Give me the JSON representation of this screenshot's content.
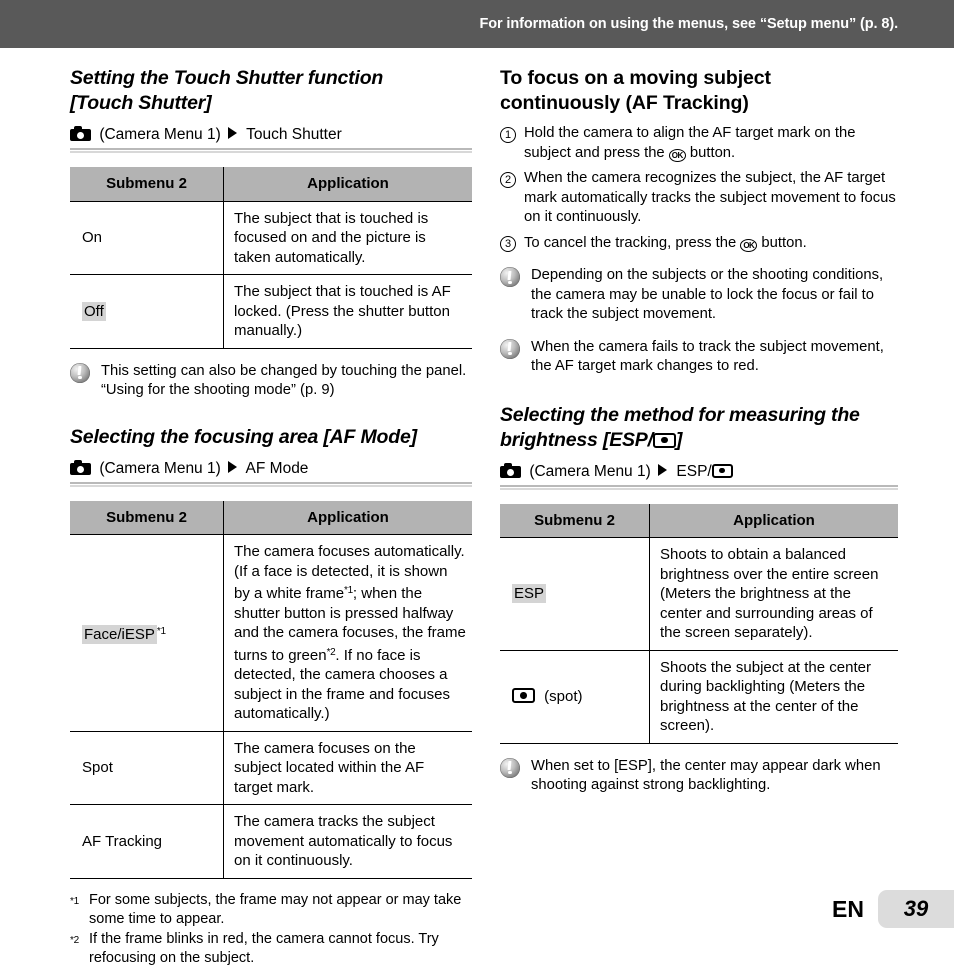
{
  "header": {
    "notice": "For information on using the menus, see “Setup menu” (p. 8)."
  },
  "left_column": {
    "touch_shutter": {
      "heading_line1": "Setting the Touch Shutter function",
      "heading_line2": "[Touch Shutter]",
      "menu_path_prefix": "(Camera Menu 1)",
      "menu_path_target": "Touch Shutter",
      "table": {
        "headers": [
          "Submenu 2",
          "Application"
        ],
        "rows": [
          {
            "submenu": "On",
            "submenu_highlighted": false,
            "application": "The subject that is touched is focused on and the picture is taken automatically."
          },
          {
            "submenu": "Off",
            "submenu_highlighted": true,
            "application": "The subject that is touched is AF locked. (Press the shutter button manually.)"
          }
        ]
      },
      "note": "This setting can also be changed by touching the panel. “Using for the shooting mode” (p. 9)"
    },
    "af_mode": {
      "heading_line1": "Selecting the focusing area [AF Mode]",
      "menu_path_prefix": "(Camera Menu 1)",
      "menu_path_target": "AF Mode",
      "table": {
        "headers": [
          "Submenu 2",
          "Application"
        ],
        "rows": [
          {
            "submenu": "Face/iESP",
            "submenu_sup": "*1",
            "submenu_highlighted": true,
            "application": "The camera focuses automatically. (If a face is detected, it is shown by a white frame",
            "application_sup1": "*1",
            "application_mid": "; when the shutter button is pressed halfway and the camera focuses, the frame turns to green",
            "application_sup2": "*2",
            "application_end": ". If no face is detected, the camera chooses a subject in the frame and focuses automatically.)"
          },
          {
            "submenu": "Spot",
            "submenu_highlighted": false,
            "application": "The camera focuses on the subject located within the AF target mark."
          },
          {
            "submenu": "AF Tracking",
            "submenu_highlighted": false,
            "application": "The camera tracks the subject movement automatically to focus on it continuously."
          }
        ]
      },
      "footnotes": [
        {
          "mark": "*1",
          "text": "For some subjects, the frame may not appear or may take some time to appear."
        },
        {
          "mark": "*2",
          "text": "If the frame blinks in red, the camera cannot focus. Try refocusing on the subject."
        }
      ]
    }
  },
  "right_column": {
    "af_tracking": {
      "heading_line1": "To focus on a moving subject",
      "heading_line2": "continuously (AF Tracking)",
      "steps": [
        {
          "num": "1",
          "text_before": "Hold the camera to align the AF target mark on the subject and press the ",
          "button": "OK",
          "text_after": " button."
        },
        {
          "num": "2",
          "text_before": "When the camera recognizes the subject, the AF target mark automatically tracks the subject movement to focus on it continuously.",
          "button": "",
          "text_after": ""
        },
        {
          "num": "3",
          "text_before": "To cancel the tracking, press the ",
          "button": "OK",
          "text_after": " button."
        }
      ],
      "notes": [
        "Depending on the subjects or the shooting conditions, the camera may be unable to lock the focus or fail to track the subject movement.",
        "When the camera fails to track the subject movement, the AF target mark changes to red."
      ]
    },
    "esp": {
      "heading_line1": "Selecting the method for measuring the",
      "heading_line2_before": "brightness [ESP/",
      "heading_line2_after": "]",
      "menu_path_prefix": "(Camera Menu 1)",
      "menu_path_target": "ESP/",
      "table": {
        "headers": [
          "Submenu 2",
          "Application"
        ],
        "rows": [
          {
            "submenu": "ESP",
            "submenu_highlighted": true,
            "is_icon": false,
            "application": "Shoots to obtain a balanced brightness over the entire screen (Meters the brightness at the center and surrounding areas of the screen separately)."
          },
          {
            "submenu": "(spot)",
            "submenu_highlighted": false,
            "is_icon": true,
            "application": "Shoots the subject at the center during backlighting (Meters the brightness at the center of the screen)."
          }
        ]
      },
      "note": "When set to [ESP], the center may appear dark when shooting against strong backlighting."
    }
  },
  "footer": {
    "language": "EN",
    "page_number": "39"
  },
  "icons": {
    "camera": "camera-icon",
    "arrow": "arrow-right-icon",
    "spot_meter": "spot-metering-icon",
    "warning": "warning-icon",
    "ok_button": "ok-button-icon"
  },
  "colors": {
    "header_bar": "#595959",
    "table_header": "#b3b3b3",
    "highlight": "#d4d4d4",
    "page_box": "#dcdcdc"
  }
}
